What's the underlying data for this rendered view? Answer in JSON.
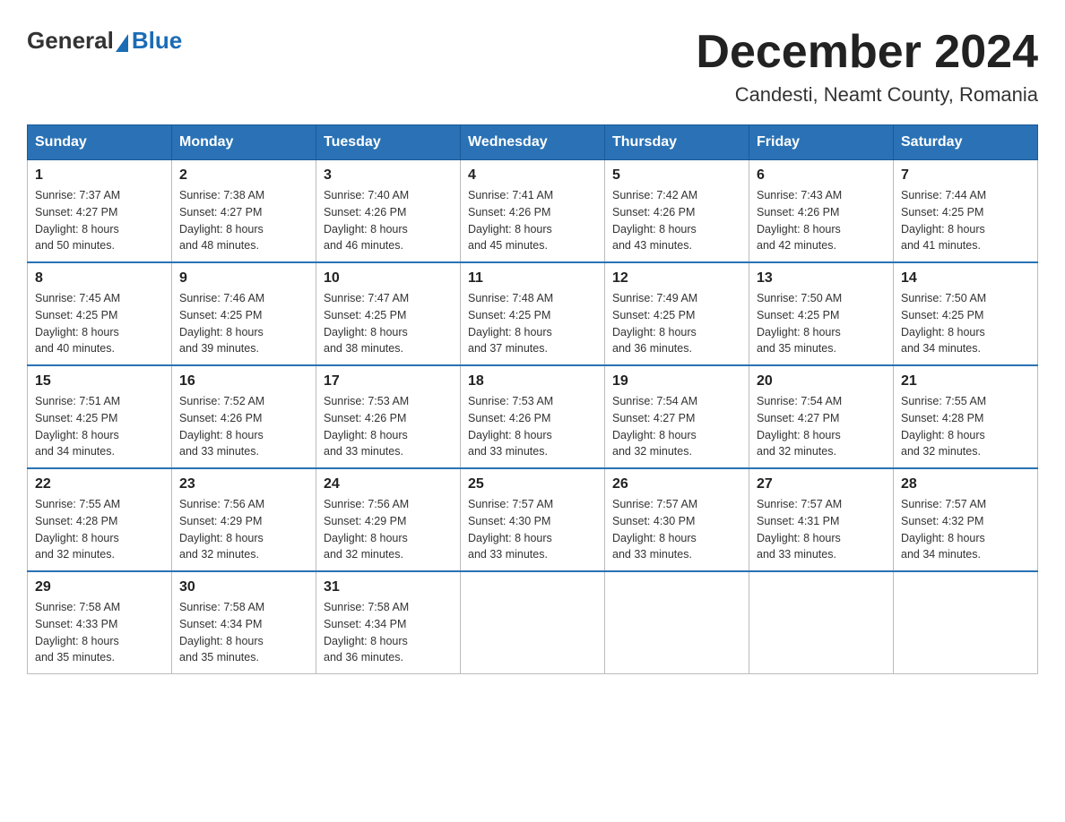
{
  "logo": {
    "general": "General",
    "blue": "Blue"
  },
  "title": "December 2024",
  "subtitle": "Candesti, Neamt County, Romania",
  "days_of_week": [
    "Sunday",
    "Monday",
    "Tuesday",
    "Wednesday",
    "Thursday",
    "Friday",
    "Saturday"
  ],
  "weeks": [
    [
      {
        "day": "1",
        "sunrise": "7:37 AM",
        "sunset": "4:27 PM",
        "daylight": "8 hours and 50 minutes."
      },
      {
        "day": "2",
        "sunrise": "7:38 AM",
        "sunset": "4:27 PM",
        "daylight": "8 hours and 48 minutes."
      },
      {
        "day": "3",
        "sunrise": "7:40 AM",
        "sunset": "4:26 PM",
        "daylight": "8 hours and 46 minutes."
      },
      {
        "day": "4",
        "sunrise": "7:41 AM",
        "sunset": "4:26 PM",
        "daylight": "8 hours and 45 minutes."
      },
      {
        "day": "5",
        "sunrise": "7:42 AM",
        "sunset": "4:26 PM",
        "daylight": "8 hours and 43 minutes."
      },
      {
        "day": "6",
        "sunrise": "7:43 AM",
        "sunset": "4:26 PM",
        "daylight": "8 hours and 42 minutes."
      },
      {
        "day": "7",
        "sunrise": "7:44 AM",
        "sunset": "4:25 PM",
        "daylight": "8 hours and 41 minutes."
      }
    ],
    [
      {
        "day": "8",
        "sunrise": "7:45 AM",
        "sunset": "4:25 PM",
        "daylight": "8 hours and 40 minutes."
      },
      {
        "day": "9",
        "sunrise": "7:46 AM",
        "sunset": "4:25 PM",
        "daylight": "8 hours and 39 minutes."
      },
      {
        "day": "10",
        "sunrise": "7:47 AM",
        "sunset": "4:25 PM",
        "daylight": "8 hours and 38 minutes."
      },
      {
        "day": "11",
        "sunrise": "7:48 AM",
        "sunset": "4:25 PM",
        "daylight": "8 hours and 37 minutes."
      },
      {
        "day": "12",
        "sunrise": "7:49 AM",
        "sunset": "4:25 PM",
        "daylight": "8 hours and 36 minutes."
      },
      {
        "day": "13",
        "sunrise": "7:50 AM",
        "sunset": "4:25 PM",
        "daylight": "8 hours and 35 minutes."
      },
      {
        "day": "14",
        "sunrise": "7:50 AM",
        "sunset": "4:25 PM",
        "daylight": "8 hours and 34 minutes."
      }
    ],
    [
      {
        "day": "15",
        "sunrise": "7:51 AM",
        "sunset": "4:25 PM",
        "daylight": "8 hours and 34 minutes."
      },
      {
        "day": "16",
        "sunrise": "7:52 AM",
        "sunset": "4:26 PM",
        "daylight": "8 hours and 33 minutes."
      },
      {
        "day": "17",
        "sunrise": "7:53 AM",
        "sunset": "4:26 PM",
        "daylight": "8 hours and 33 minutes."
      },
      {
        "day": "18",
        "sunrise": "7:53 AM",
        "sunset": "4:26 PM",
        "daylight": "8 hours and 33 minutes."
      },
      {
        "day": "19",
        "sunrise": "7:54 AM",
        "sunset": "4:27 PM",
        "daylight": "8 hours and 32 minutes."
      },
      {
        "day": "20",
        "sunrise": "7:54 AM",
        "sunset": "4:27 PM",
        "daylight": "8 hours and 32 minutes."
      },
      {
        "day": "21",
        "sunrise": "7:55 AM",
        "sunset": "4:28 PM",
        "daylight": "8 hours and 32 minutes."
      }
    ],
    [
      {
        "day": "22",
        "sunrise": "7:55 AM",
        "sunset": "4:28 PM",
        "daylight": "8 hours and 32 minutes."
      },
      {
        "day": "23",
        "sunrise": "7:56 AM",
        "sunset": "4:29 PM",
        "daylight": "8 hours and 32 minutes."
      },
      {
        "day": "24",
        "sunrise": "7:56 AM",
        "sunset": "4:29 PM",
        "daylight": "8 hours and 32 minutes."
      },
      {
        "day": "25",
        "sunrise": "7:57 AM",
        "sunset": "4:30 PM",
        "daylight": "8 hours and 33 minutes."
      },
      {
        "day": "26",
        "sunrise": "7:57 AM",
        "sunset": "4:30 PM",
        "daylight": "8 hours and 33 minutes."
      },
      {
        "day": "27",
        "sunrise": "7:57 AM",
        "sunset": "4:31 PM",
        "daylight": "8 hours and 33 minutes."
      },
      {
        "day": "28",
        "sunrise": "7:57 AM",
        "sunset": "4:32 PM",
        "daylight": "8 hours and 34 minutes."
      }
    ],
    [
      {
        "day": "29",
        "sunrise": "7:58 AM",
        "sunset": "4:33 PM",
        "daylight": "8 hours and 35 minutes."
      },
      {
        "day": "30",
        "sunrise": "7:58 AM",
        "sunset": "4:34 PM",
        "daylight": "8 hours and 35 minutes."
      },
      {
        "day": "31",
        "sunrise": "7:58 AM",
        "sunset": "4:34 PM",
        "daylight": "8 hours and 36 minutes."
      },
      null,
      null,
      null,
      null
    ]
  ],
  "labels": {
    "sunrise": "Sunrise:",
    "sunset": "Sunset:",
    "daylight": "Daylight:"
  }
}
